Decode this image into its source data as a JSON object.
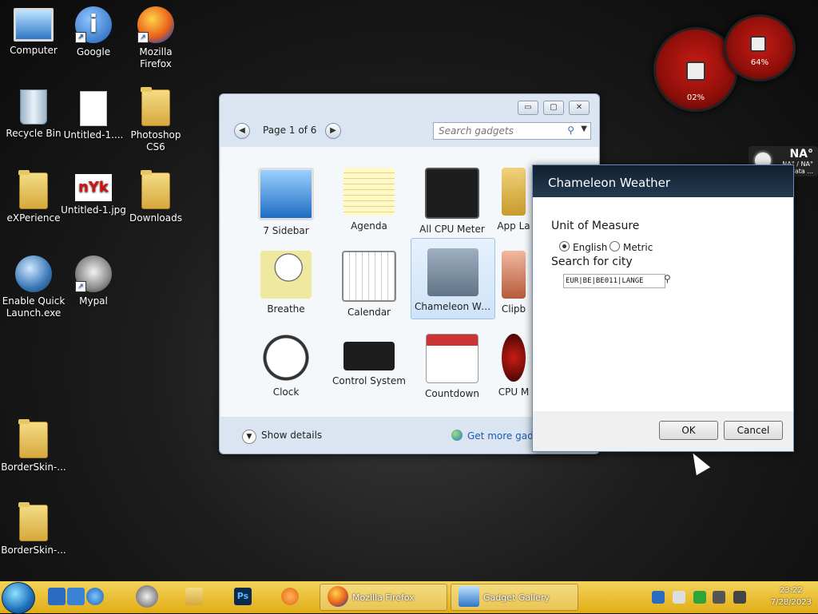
{
  "desktop": {
    "icons": [
      {
        "label": "Computer"
      },
      {
        "label": "Google"
      },
      {
        "label": "Mozilla Firefox"
      },
      {
        "label": "Recycle Bin"
      },
      {
        "label": "Untitled-1...."
      },
      {
        "label": "Photoshop CS6"
      },
      {
        "label": "eXPerience"
      },
      {
        "label": "Untitled-1.jpg"
      },
      {
        "label": "Downloads"
      },
      {
        "label": "Enable Quick Launch.exe"
      },
      {
        "label": "Mypal"
      },
      {
        "label": "BorderSkin-..."
      },
      {
        "label": "BorderSkin-..."
      }
    ]
  },
  "gallery": {
    "page_indicator": "Page 1 of 6",
    "search_placeholder": "Search gadgets",
    "gadgets": [
      {
        "label": "7 Sidebar"
      },
      {
        "label": "Agenda"
      },
      {
        "label": "All CPU Meter"
      },
      {
        "label": "App La"
      },
      {
        "label": "Breathe"
      },
      {
        "label": "Calendar"
      },
      {
        "label": "Chameleon We..."
      },
      {
        "label": "Clipb"
      },
      {
        "label": "Clock"
      },
      {
        "label": "Control System"
      },
      {
        "label": "Countdown"
      },
      {
        "label": "CPU M"
      }
    ],
    "show_details": "Show details",
    "get_more": "Get more gadge"
  },
  "weather_dialog": {
    "title": "Chameleon Weather",
    "unit_label": "Unit of Measure",
    "unit_english": "English",
    "unit_metric": "Metric",
    "city_label": "Search for city",
    "city_value": "EUR|BE|BE011|LANGE",
    "ok": "OK",
    "cancel": "Cancel"
  },
  "cpu_meter": {
    "cpu_value": "02%",
    "mem_value": "64%",
    "cpu_fraction": 0.02,
    "mem_fraction": 0.64
  },
  "weather_mini": {
    "temp": "NA°",
    "sub": "NA° / NA°",
    "status": "No data ..."
  },
  "taskbar": {
    "task_firefox": "Mozilla Firefox",
    "task_gallery": "Gadget Gallery",
    "time": "23:22",
    "date": "7/28/2023"
  },
  "colors": {
    "taskbar": "#e9c12a",
    "accent": "#1a5bb5",
    "gauge": "#c81b14"
  }
}
